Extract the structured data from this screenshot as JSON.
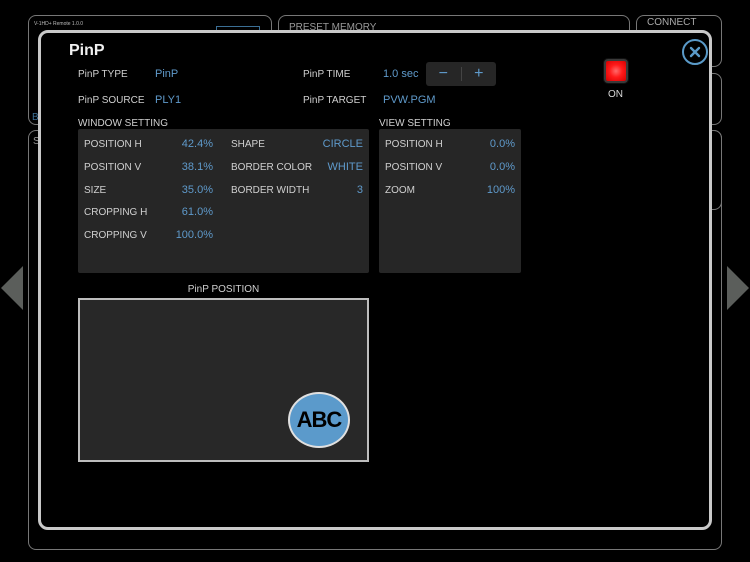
{
  "background": {
    "app_version": "V-1HD+ Remote 1.0.0",
    "preset_memory_label": "PRESET MEMORY",
    "connect_label": "CONNECT",
    "partial_label_b": "B",
    "partial_label_s": "S"
  },
  "dialog": {
    "title": "PinP",
    "close_icon": "close-icon",
    "pinp_type": {
      "label": "PinP TYPE",
      "value": "PinP"
    },
    "pinp_source": {
      "label": "PinP SOURCE",
      "value": "PLY1"
    },
    "pinp_time": {
      "label": "PinP TIME",
      "value": "1.0 sec",
      "minus": "−",
      "plus": "+"
    },
    "pinp_target": {
      "label": "PinP TARGET",
      "value": "PVW.PGM"
    },
    "on_button": {
      "label": "ON",
      "color": "#ff1a1a",
      "state": "on"
    },
    "window_setting": {
      "title": "WINDOW SETTING",
      "left": [
        {
          "label": "POSITION H",
          "value": "42.4%"
        },
        {
          "label": "POSITION V",
          "value": "38.1%"
        },
        {
          "label": "SIZE",
          "value": "35.0%"
        },
        {
          "label": "CROPPING H",
          "value": "61.0%"
        },
        {
          "label": "CROPPING V",
          "value": "100.0%"
        }
      ],
      "right": [
        {
          "label": "SHAPE",
          "value": "CIRCLE"
        },
        {
          "label": "BORDER COLOR",
          "value": "WHITE"
        },
        {
          "label": "BORDER WIDTH",
          "value": "3"
        }
      ]
    },
    "view_setting": {
      "title": "VIEW SETTING",
      "items": [
        {
          "label": "POSITION H",
          "value": "0.0%"
        },
        {
          "label": "POSITION V",
          "value": "0.0%"
        },
        {
          "label": "ZOOM",
          "value": "100%"
        }
      ]
    },
    "position_preview": {
      "title": "PinP POSITION",
      "window_text": "ABC",
      "window_color": "#5b9acb"
    }
  },
  "navigation": {
    "prev": "left-arrow-icon",
    "next": "right-arrow-icon"
  }
}
